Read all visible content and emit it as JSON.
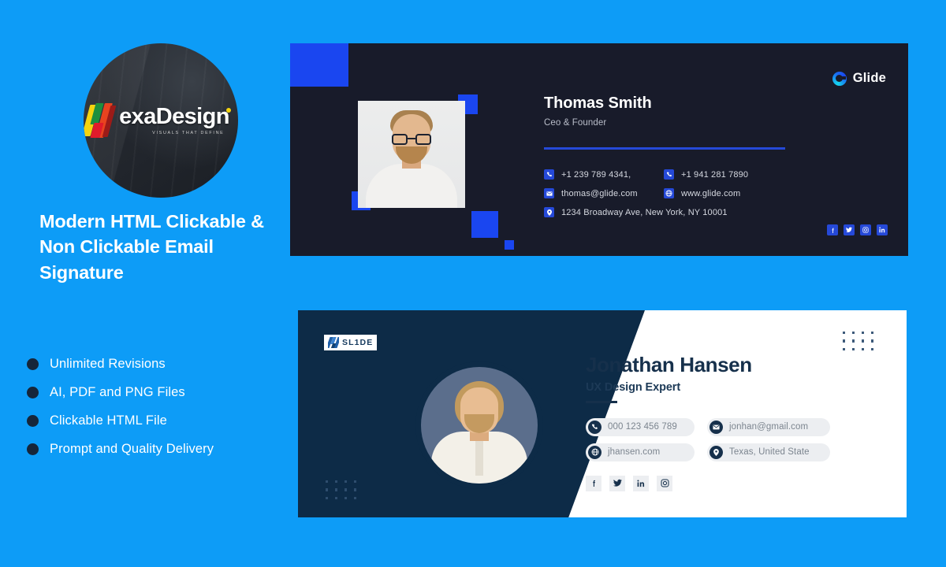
{
  "promo": {
    "logo": {
      "mark": "nexa-logo-mark",
      "word": "exaDesign",
      "tagline": "VISUALS THAT DEFINE"
    },
    "headline": "Modern HTML Clickable & Non Clickable Email Signature",
    "features": [
      {
        "label": "Unlimited Revisions"
      },
      {
        "label": "AI, PDF and PNG Files"
      },
      {
        "label": "Clickable HTML File"
      },
      {
        "label": "Prompt and Quality Delivery"
      }
    ]
  },
  "card1": {
    "brand": {
      "name": "Glide",
      "icon": "glide-g-icon"
    },
    "name": "Thomas Smith",
    "role": "Ceo & Founder",
    "contacts": [
      {
        "icon": "phone-icon",
        "text": "+1 239 789 4341,"
      },
      {
        "icon": "phone-icon",
        "text": "+1 941 281 7890"
      },
      {
        "icon": "mail-icon",
        "text": "thomas@glide.com"
      },
      {
        "icon": "globe-icon",
        "text": "www.glide.com"
      },
      {
        "icon": "location-icon",
        "text": "1234 Broadway Ave, New York, NY 10001"
      }
    ],
    "social": [
      {
        "icon": "facebook-icon",
        "label": "f"
      },
      {
        "icon": "twitter-icon",
        "label": "t"
      },
      {
        "icon": "instagram-icon",
        "label": "ig"
      },
      {
        "icon": "linkedin-icon",
        "label": "in"
      }
    ]
  },
  "card2": {
    "logo": {
      "wordmark": "SL1DE",
      "mark": "slide-logo-mark"
    },
    "name": "Jonathan Hansen",
    "role": "UX Design Expert",
    "contacts": [
      {
        "icon": "phone-icon",
        "text": "000 123 456 789"
      },
      {
        "icon": "mail-icon",
        "text": "jonhan@gmail.com"
      },
      {
        "icon": "globe-icon",
        "text": "jhansen.com"
      },
      {
        "icon": "location-icon",
        "text": "Texas, United State"
      }
    ],
    "social": [
      {
        "icon": "facebook-icon",
        "label": "f"
      },
      {
        "icon": "twitter-icon",
        "label": "t"
      },
      {
        "icon": "linkedin-icon",
        "label": "in"
      },
      {
        "icon": "instagram-icon",
        "label": "ig"
      }
    ]
  },
  "colors": {
    "background": "#0d9cf7",
    "card1_bg": "#181b2a",
    "accent_blue": "#1a46f0",
    "card2_navy": "#0d2b47",
    "chip_bg": "#eceef1"
  }
}
